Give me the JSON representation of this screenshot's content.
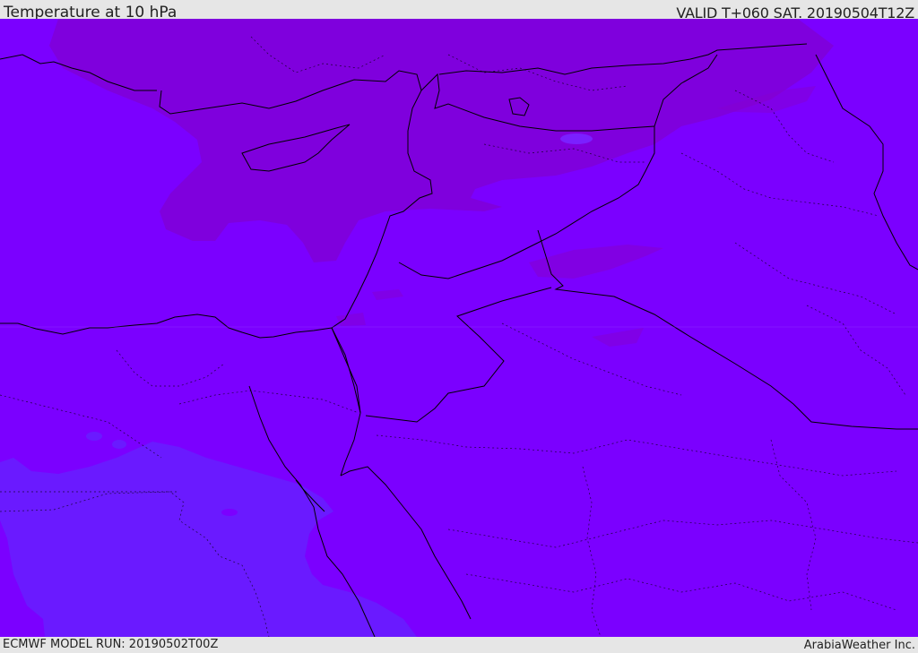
{
  "header": {
    "title": "Temperature at 10 hPa",
    "valid": "VALID T+060 SAT. 20190504T12Z"
  },
  "footer": {
    "model_run": "ECMWF MODEL RUN: 20190502T00Z",
    "credit": "ArabiaWeather Inc."
  },
  "map": {
    "colors": {
      "base": "#7b00ff",
      "warm_band": "#7f00dd",
      "warm_spot": "#8500d0",
      "cool_region": "#6a1aff",
      "coastline": "#000000"
    }
  }
}
